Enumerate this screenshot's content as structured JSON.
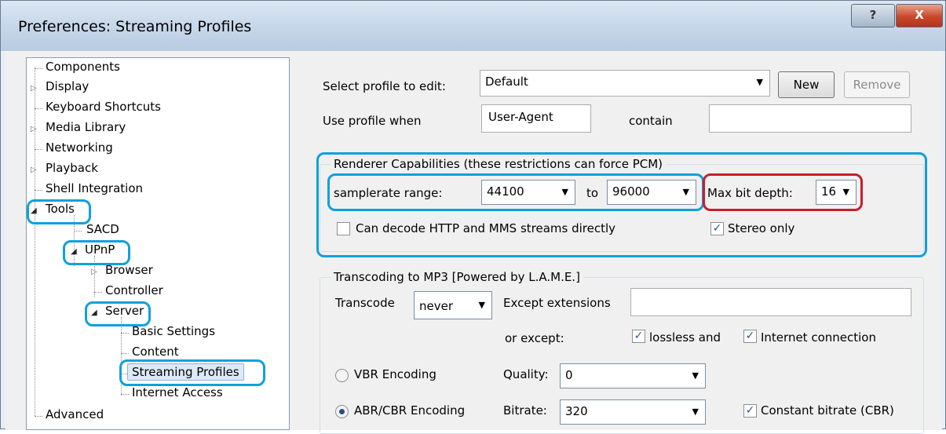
{
  "window": {
    "title": "Preferences: Streaming Profiles",
    "help_label": "?",
    "close_label": "X"
  },
  "tree": {
    "components": "Components",
    "display": "Display",
    "keyboard_shortcuts": "Keyboard Shortcuts",
    "media_library": "Media Library",
    "networking": "Networking",
    "playback": "Playback",
    "shell_integration": "Shell Integration",
    "tools": "Tools",
    "sacd": "SACD",
    "upnp": "UPnP",
    "browser": "Browser",
    "controller": "Controller",
    "server": "Server",
    "basic_settings": "Basic Settings",
    "content": "Content",
    "streaming_profiles": "Streaming Profiles",
    "internet_access": "Internet Access",
    "advanced": "Advanced"
  },
  "profile": {
    "select_label": "Select profile to edit:",
    "selected": "Default",
    "new_label": "New",
    "remove_label": "Remove",
    "use_when_label": "Use profile when",
    "header_value": "User-Agent",
    "contain_label": "contain",
    "contain_value": ""
  },
  "renderer": {
    "group_title": "Renderer Capabilities (these restrictions can force PCM)",
    "samplerate_label": "samplerate range:",
    "min_rate": "44100",
    "to_label": "to",
    "max_rate": "96000",
    "bitdepth_label": "Max bit depth:",
    "bitdepth": "16",
    "decode_label": "Can decode  HTTP and MMS  streams directly",
    "decode_checked": false,
    "stereo_label": "Stereo only",
    "stereo_checked": true
  },
  "transcoding": {
    "group_title": "Transcoding to MP3 [Powered by L.A.M.E.]",
    "transcode_label": "Transcode",
    "transcode_value": "never",
    "except_ext_label": "Except extensions",
    "except_ext_value": "",
    "or_except_label": "or except:",
    "lossless_label": "lossless and",
    "internet_label": "Internet connection",
    "vbr_label": "VBR Encoding",
    "quality_label": "Quality:",
    "quality_value": "0",
    "abr_label": "ABR/CBR Encoding",
    "bitrate_label": "Bitrate:",
    "bitrate_value": "320",
    "cbr_label": "Constant bitrate (CBR)"
  },
  "glyphs": {
    "check": "✓",
    "caret": "▼",
    "arrow_closed": "▷",
    "arrow_open": "◢"
  },
  "colors": {
    "highlight_blue": "#10a0dc",
    "highlight_red": "#c81e2a"
  }
}
